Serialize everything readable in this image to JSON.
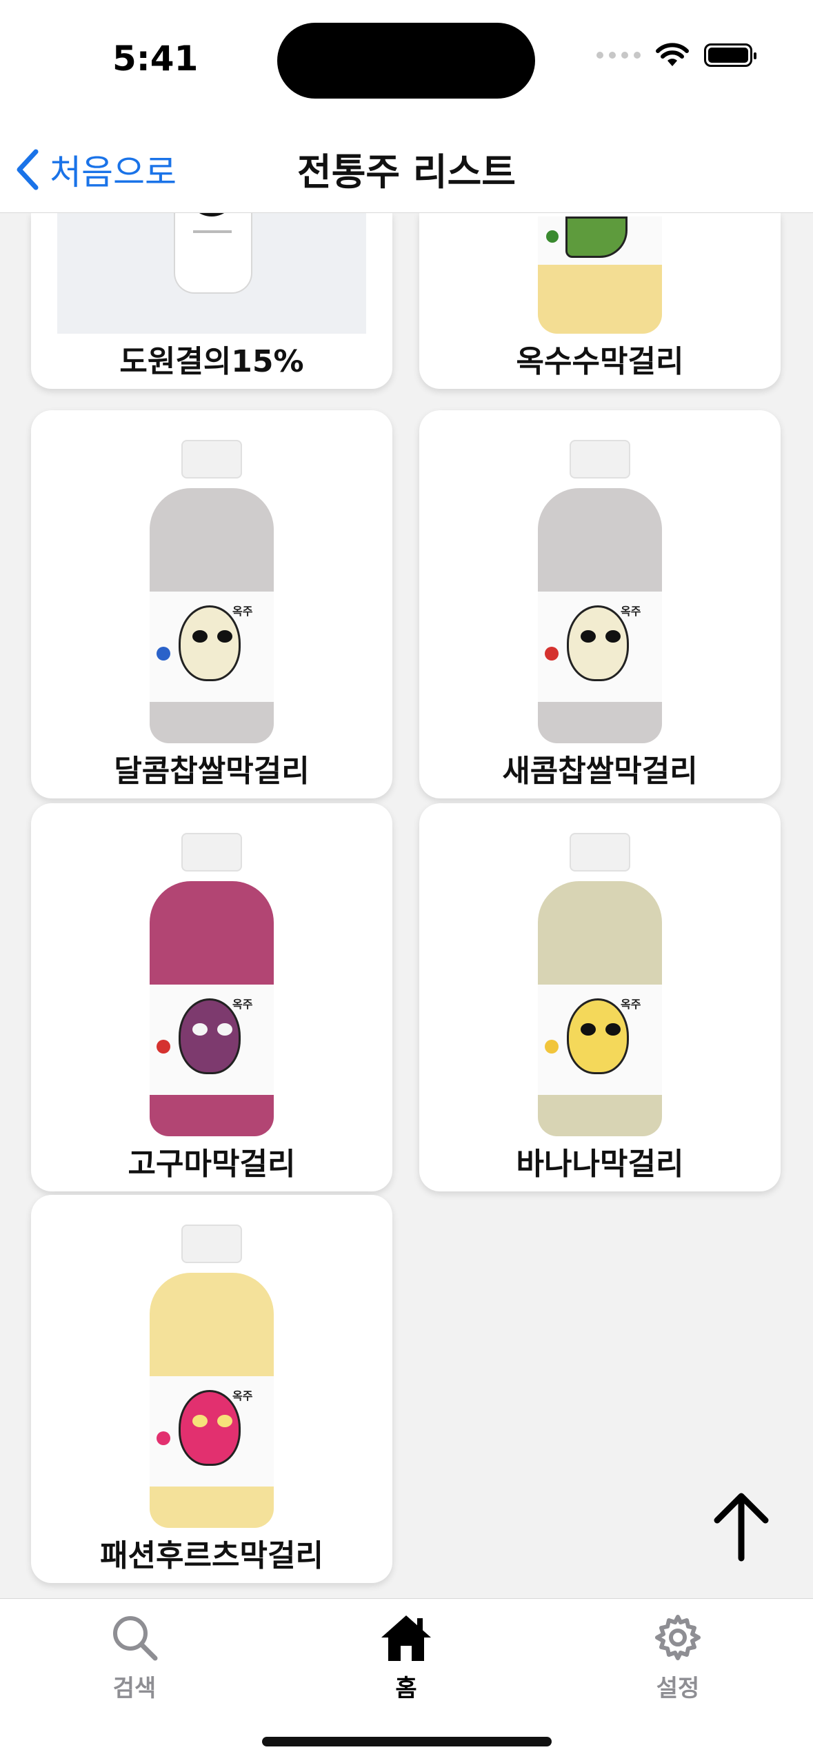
{
  "status_bar": {
    "time": "5:41"
  },
  "nav": {
    "back_label": "처음으로",
    "title": "전통주 리스트"
  },
  "products": [
    {
      "name": "도원결의15%",
      "color": "#eef0f3"
    },
    {
      "name": "옥수수막걸리",
      "color": "#f3dd93"
    },
    {
      "name": "달콤찹쌀막걸리",
      "color": "#cfcccc",
      "accent": "#2a62c9"
    },
    {
      "name": "새콤찹쌀막걸리",
      "color": "#cfcccc",
      "accent": "#d5322f"
    },
    {
      "name": "고구마막걸리",
      "color": "#b24573",
      "accent": "#d5322f"
    },
    {
      "name": "바나나막걸리",
      "color": "#d8d4b4",
      "accent": "#f1c53c"
    },
    {
      "name": "패션후르츠막걸리",
      "color": "#f4e19a",
      "accent": "#e2306f"
    }
  ],
  "tabs": [
    {
      "label": "검색",
      "icon": "search-icon",
      "active": false
    },
    {
      "label": "홈",
      "icon": "home-icon",
      "active": true
    },
    {
      "label": "설정",
      "icon": "gear-icon",
      "active": false
    }
  ],
  "colors": {
    "accent_blue": "#1a73e8",
    "inactive_tab": "#8e8e93",
    "active_tab": "#000000"
  }
}
